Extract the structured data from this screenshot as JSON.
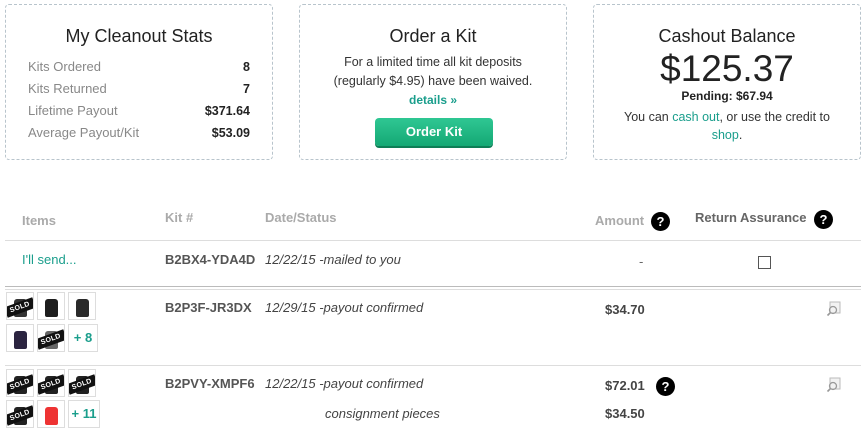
{
  "stats": {
    "title": "My Cleanout Stats",
    "rows": [
      {
        "label": "Kits Ordered",
        "value": "8"
      },
      {
        "label": "Kits Returned",
        "value": "7"
      },
      {
        "label": "Lifetime Payout",
        "value": "$371.64"
      },
      {
        "label": "Average Payout/Kit",
        "value": "$53.09"
      }
    ]
  },
  "kit": {
    "title": "Order a Kit",
    "line1": "For a limited time all kit deposits",
    "line2": "(regularly $4.95) have been waived.",
    "details_link": "details »",
    "button": "Order Kit"
  },
  "cashout": {
    "title": "Cashout Balance",
    "balance": "$125.37",
    "pending": "Pending: $67.94",
    "note_pre": "You can ",
    "cash_out_link": "cash out",
    "note_mid": ", or use the credit to",
    "shop_link": "shop",
    "note_post": "."
  },
  "table": {
    "headers": {
      "items": "Items",
      "kit": "Kit #",
      "date_status": "Date/Status",
      "amount": "Amount",
      "return_assurance": "Return Assurance"
    },
    "help_glyph": "?",
    "rows": [
      {
        "items_link": "I'll send...",
        "kit": "B2BX4-YDA4D",
        "status": "12/22/15 -mailed to you",
        "amount": "-"
      },
      {
        "kit": "B2P3F-JR3DX",
        "status": "12/29/15 -payout confirmed",
        "amount": "$34.70",
        "more": "+ 8"
      },
      {
        "kit": "B2PVY-XMPF6",
        "status": "12/22/15 -payout confirmed",
        "amount": "$72.01",
        "more": "+ 11",
        "sub_label": "consignment pieces",
        "sub_amount": "$34.50"
      }
    ],
    "sold_badge": "SOLD"
  },
  "colors": {
    "accent": "#1a9e8c",
    "button": "#14a874"
  },
  "icons": {
    "help": "question-circle-icon",
    "view": "magnifier-icon"
  }
}
